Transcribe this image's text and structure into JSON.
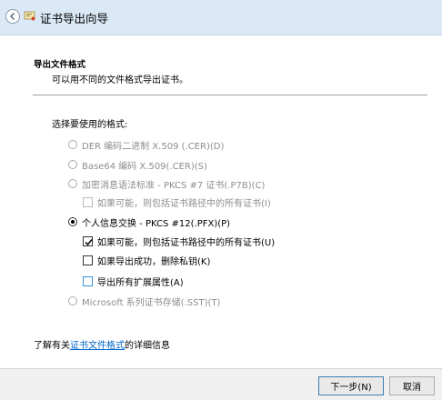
{
  "window": {
    "title": "证书导出向导"
  },
  "header": {
    "heading": "导出文件格式",
    "subheading": "可以用不同的文件格式导出证书。"
  },
  "prompt": "选择要使用的格式:",
  "options": {
    "der": "DER 编码二进制 X.509 (.CER)(D)",
    "base64": "Base64 编码 X.509(.CER)(S)",
    "pkcs7": "加密消息语法标准 - PKCS #7 证书(.P7B)(C)",
    "pkcs7_include_chain": "如果可能，则包括证书路径中的所有证书(I)",
    "pfx": "个人信息交换 - PKCS #12(.PFX)(P)",
    "pfx_include_chain": "如果可能，则包括证书路径中的所有证书(U)",
    "pfx_delete_key": "如果导出成功，删除私钥(K)",
    "pfx_export_ext": "导出所有扩展属性(A)",
    "sst": "Microsoft 系列证书存储(.SST)(T)"
  },
  "info": {
    "prefix": "了解有关",
    "link": "证书文件格式",
    "suffix": "的详细信息"
  },
  "buttons": {
    "next": "下一步(N)",
    "cancel": "取消"
  }
}
